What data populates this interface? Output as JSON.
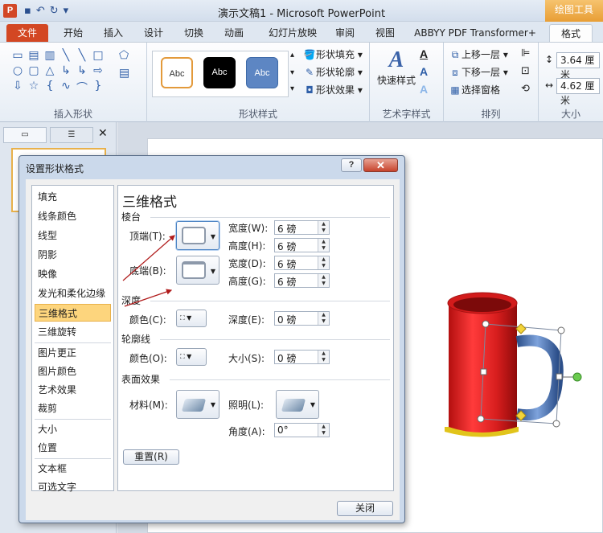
{
  "app": {
    "title": "演示文稿1 - Microsoft PowerPoint",
    "context_tools": "绘图工具"
  },
  "tabs": [
    "文件",
    "开始",
    "插入",
    "设计",
    "切换",
    "动画",
    "幻灯片放映",
    "审阅",
    "视图",
    "ABBYY PDF Transformer+",
    "格式"
  ],
  "ribbon": {
    "groups": {
      "insert_shapes": "插入形状",
      "shape_styles": "形状样式",
      "wordart_styles": "艺术字样式",
      "arrange": "排列",
      "size": "大小"
    },
    "style_sample": "Abc",
    "shape_fill": "形状填充",
    "shape_outline": "形状轮廓",
    "shape_effects": "形状效果",
    "quick_styles": "快速样式",
    "bring_forward": "上移一层",
    "send_backward": "下移一层",
    "selection_pane": "选择窗格",
    "height": "3.64 厘米",
    "width": "4.62 厘米"
  },
  "dialog": {
    "title": "设置形状格式",
    "help": "?",
    "close_x": "✕",
    "categories": [
      "填充",
      "线条颜色",
      "线型",
      "阴影",
      "映像",
      "发光和柔化边缘",
      "三维格式",
      "三维旋转",
      "图片更正",
      "图片颜色",
      "艺术效果",
      "裁剪",
      "大小",
      "位置",
      "文本框",
      "可选文字"
    ],
    "selected_category": "三维格式",
    "section_title": "三维格式",
    "bevel": {
      "heading": "棱台",
      "top": "顶端(T):",
      "bottom": "底端(B):",
      "width_label": "宽度(W):",
      "height_label": "高度(H):",
      "width2_label": "宽度(D):",
      "height2_label": "高度(G):",
      "top_width": "6 磅",
      "top_height": "6 磅",
      "bottom_width": "6 磅",
      "bottom_height": "6 磅"
    },
    "depth": {
      "heading": "深度",
      "color": "颜色(C):",
      "depth_label": "深度(E):",
      "depth_value": "0 磅"
    },
    "contour": {
      "heading": "轮廓线",
      "color": "颜色(O):",
      "size_label": "大小(S):",
      "size_value": "0 磅"
    },
    "surface": {
      "heading": "表面效果",
      "material": "材料(M):",
      "lighting": "照明(L):",
      "angle_label": "角度(A):",
      "angle_value": "0°"
    },
    "reset": "重置(R)",
    "close": "关闭"
  },
  "colors": {
    "file_tab": "#d34723",
    "selected_item": "#fdd57d",
    "mug_red": "#d81e1e",
    "handle_blue": "#3f6eb5",
    "annotation_arrow": "#b01b1b"
  }
}
